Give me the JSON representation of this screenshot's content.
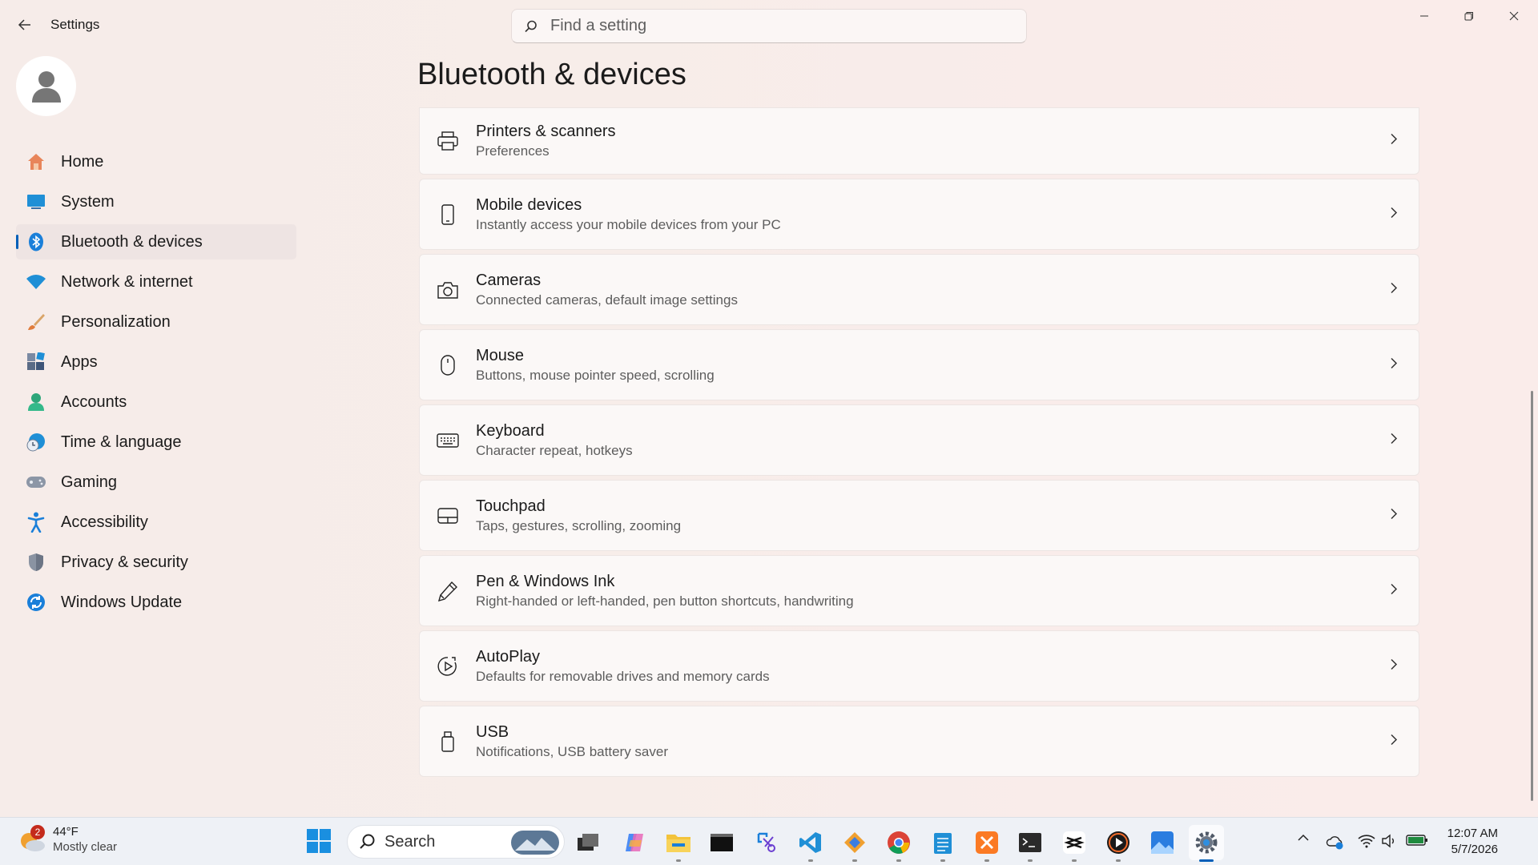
{
  "window": {
    "app_title": "Settings",
    "search_placeholder": "Find a setting"
  },
  "sidebar": {
    "items": [
      {
        "label": "Home",
        "icon": "home-icon"
      },
      {
        "label": "System",
        "icon": "system-icon"
      },
      {
        "label": "Bluetooth & devices",
        "icon": "bluetooth-icon",
        "active": true
      },
      {
        "label": "Network & internet",
        "icon": "wifi-icon"
      },
      {
        "label": "Personalization",
        "icon": "brush-icon"
      },
      {
        "label": "Apps",
        "icon": "apps-icon"
      },
      {
        "label": "Accounts",
        "icon": "accounts-icon"
      },
      {
        "label": "Time & language",
        "icon": "globe-clock-icon"
      },
      {
        "label": "Gaming",
        "icon": "gamepad-icon"
      },
      {
        "label": "Accessibility",
        "icon": "accessibility-icon"
      },
      {
        "label": "Privacy & security",
        "icon": "shield-icon"
      },
      {
        "label": "Windows Update",
        "icon": "update-icon"
      }
    ]
  },
  "main": {
    "title": "Bluetooth & devices",
    "cards": [
      {
        "title": "Printers & scanners",
        "subtitle": "Preferences",
        "icon": "printer-icon"
      },
      {
        "title": "Mobile devices",
        "subtitle": "Instantly access your mobile devices from your PC",
        "icon": "phone-icon"
      },
      {
        "title": "Cameras",
        "subtitle": "Connected cameras, default image settings",
        "icon": "camera-icon"
      },
      {
        "title": "Mouse",
        "subtitle": "Buttons, mouse pointer speed, scrolling",
        "icon": "mouse-icon"
      },
      {
        "title": "Keyboard",
        "subtitle": "Character repeat, hotkeys",
        "icon": "keyboard-icon"
      },
      {
        "title": "Touchpad",
        "subtitle": "Taps, gestures, scrolling, zooming",
        "icon": "touchpad-icon"
      },
      {
        "title": "Pen & Windows Ink",
        "subtitle": "Right-handed or left-handed, pen button shortcuts, handwriting",
        "icon": "pen-icon"
      },
      {
        "title": "AutoPlay",
        "subtitle": "Defaults for removable drives and memory cards",
        "icon": "autoplay-icon"
      },
      {
        "title": "USB",
        "subtitle": "Notifications, USB battery saver",
        "icon": "usb-icon"
      }
    ]
  },
  "taskbar": {
    "weather_temp": "44°F",
    "weather_desc": "Mostly clear",
    "weather_badge": "2",
    "search_label": "Search",
    "time": "12:07 AM",
    "date": "5/7/2026"
  },
  "colors": {
    "accent": "#005fb8"
  }
}
